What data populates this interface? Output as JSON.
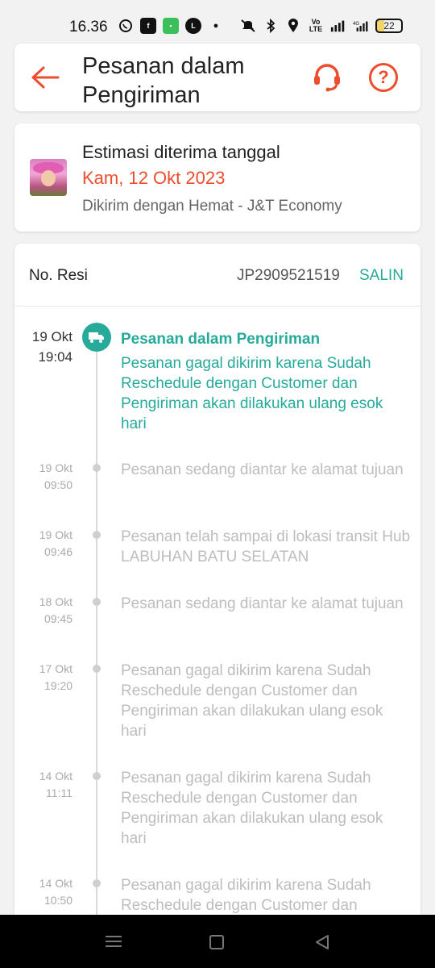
{
  "status_bar": {
    "time": "16.36",
    "battery": "22"
  },
  "header": {
    "title": "Pesanan dalam Pengiriman"
  },
  "estimate": {
    "label": "Estimasi diterima tanggal",
    "date": "Kam, 12 Okt 2023",
    "courier": "Dikirim dengan Hemat - J&T Economy"
  },
  "tracking": {
    "resi_label": "No. Resi",
    "resi_number": "JP2909521519",
    "copy_label": "SALIN",
    "events": [
      {
        "date": "19 Okt",
        "time": "19:04",
        "title": "Pesanan dalam Pengiriman",
        "text": "Pesanan gagal dikirim karena Sudah Reschedule dengan Customer dan Pengiriman akan dilakukan ulang esok hari"
      },
      {
        "date": "19 Okt",
        "time": "09:50",
        "text": "Pesanan sedang diantar ke alamat tujuan"
      },
      {
        "date": "19 Okt",
        "time": "09:46",
        "text": "Pesanan telah sampai di lokasi transit Hub LABUHAN BATU SELATAN"
      },
      {
        "date": "18 Okt",
        "time": "09:45",
        "text": "Pesanan sedang diantar ke alamat tujuan"
      },
      {
        "date": "17 Okt",
        "time": "19:20",
        "text": "Pesanan gagal dikirim karena Sudah Reschedule dengan Customer dan Pengiriman akan dilakukan ulang esok hari"
      },
      {
        "date": "14 Okt",
        "time": "11:11",
        "text": "Pesanan gagal dikirim karena Sudah Reschedule dengan Customer dan Pengiriman akan dilakukan ulang esok hari"
      },
      {
        "date": "14 Okt",
        "time": "10:50",
        "text": "Pesanan gagal dikirim karena Sudah Reschedule dengan Customer dan"
      }
    ]
  },
  "colors": {
    "accent": "#ee4d2d",
    "teal": "#26aa99"
  }
}
